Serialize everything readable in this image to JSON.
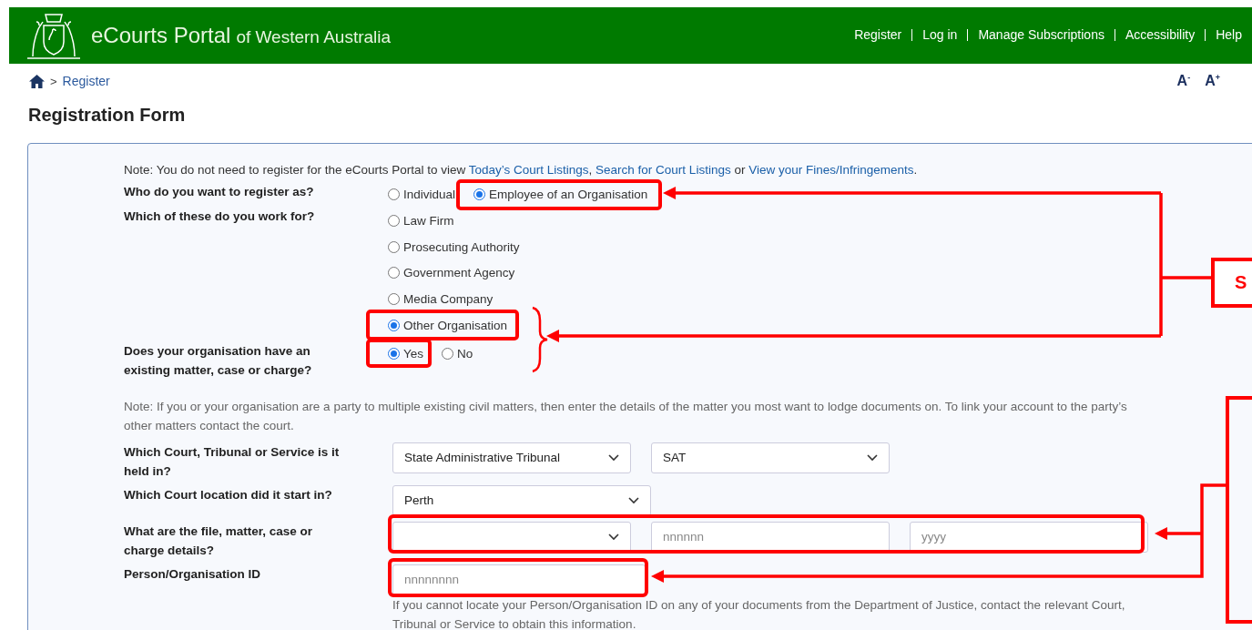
{
  "header": {
    "title": "eCourts Portal",
    "subtitle": "of Western Australia",
    "nav": [
      "Register",
      "Log in",
      "Manage Subscriptions",
      "Accessibility",
      "Help"
    ]
  },
  "breadcrumb": {
    "separator": ">",
    "current": "Register"
  },
  "font_size_buttons": [
    "A$^{-}$",
    "A$^{+}$"
  ],
  "page_title": "Registration Form",
  "rows": [
    {
      "kind": "note",
      "segments": [
        {
          "kind": "text",
          "text": "Note: You do not need to register for the eCourts Portal to view "
        },
        {
          "kind": "link",
          "text": "Today’s Court Listings"
        },
        {
          "kind": "text",
          "text": ", "
        },
        {
          "kind": "link",
          "text": "Search for Court Listings"
        },
        {
          "kind": "text",
          "text": " or "
        },
        {
          "kind": "link",
          "text": "View your Fines/Infringements"
        },
        {
          "kind": "text",
          "text": "."
        }
      ]
    },
    {
      "kind": "radio_row",
      "label": "Who do you want to register as?",
      "options": [
        {
          "label": "Individual",
          "selected": false
        },
        {
          "label": "Employee of an Organisation",
          "selected": true
        }
      ]
    },
    {
      "kind": "radio_list",
      "label": "Which of these do you work for?",
      "options": [
        {
          "label": "Law Firm",
          "selected": false
        },
        {
          "label": "Prosecuting Authority",
          "selected": false
        },
        {
          "label": "Government Agency",
          "selected": false
        },
        {
          "label": "Media Company",
          "selected": false
        },
        {
          "label": "Other Organisation",
          "selected": true
        }
      ]
    },
    {
      "kind": "radio_row",
      "label": "Does your organisation have an existing matter, case or charge?",
      "options": [
        {
          "label": "Yes",
          "selected": true
        },
        {
          "label": "No",
          "selected": false
        }
      ]
    },
    {
      "kind": "hint",
      "text": "Note: If you or your organisation are a party to multiple existing civil matters, then enter the details of the matter you most want to lodge documents on. To link your account to the party’s other matters contact the court."
    },
    {
      "kind": "fields",
      "label": "Which Court, Tribunal or Service is it held in?",
      "controls": [
        {
          "kind": "select",
          "value": "State Administrative Tribunal"
        },
        {
          "kind": "select",
          "value": "SAT"
        }
      ]
    },
    {
      "kind": "fields",
      "label": "Which Court location did it start in?",
      "controls": [
        {
          "kind": "select",
          "value": "Perth"
        }
      ]
    },
    {
      "kind": "fields",
      "label": "What are the file, matter, case or charge details?",
      "controls": [
        {
          "kind": "select"
        },
        {
          "kind": "input",
          "placeholder": "nnnnnn"
        },
        {
          "kind": "input",
          "placeholder": "yyyy"
        }
      ]
    },
    {
      "kind": "fields",
      "label": "Person/Organisation ID",
      "controls": [
        {
          "kind": "input",
          "placeholder": "nnnnnnnn"
        }
      ],
      "help": "If you cannot locate your Person/Organisation ID on any of your documents from the Department of Justice, contact the relevant Court, Tribunal or Service to obtain this information."
    }
  ],
  "annotation": {
    "callout_label": "S"
  }
}
